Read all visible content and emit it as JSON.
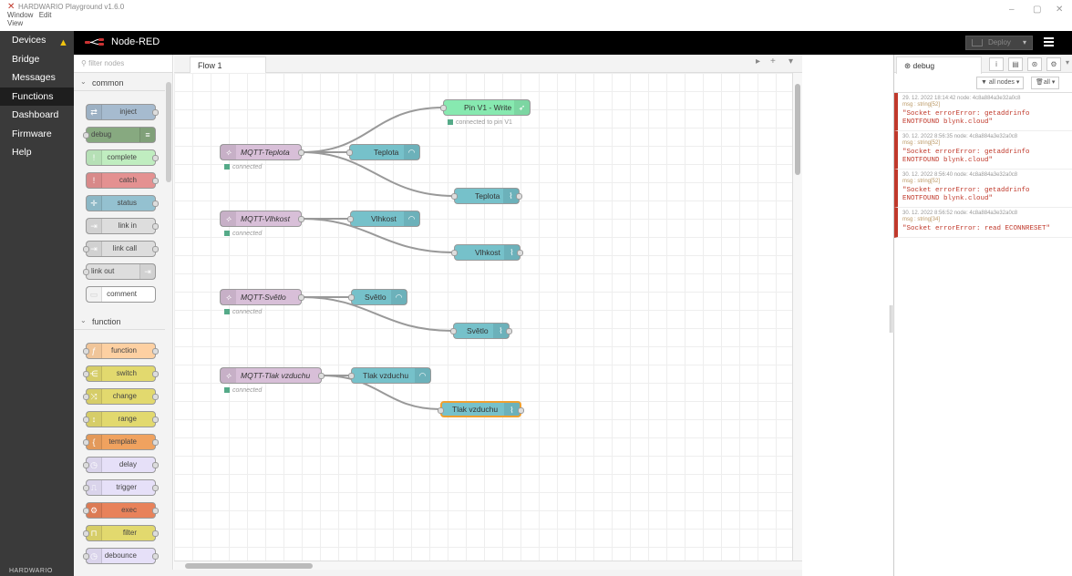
{
  "window": {
    "title": "HARDWARIO Playground v1.6.0",
    "menu": [
      "Window",
      "Edit",
      "View"
    ]
  },
  "app_nav": {
    "items": [
      {
        "label": "Devices",
        "warning": true
      },
      {
        "label": "Bridge"
      },
      {
        "label": "Messages"
      },
      {
        "label": "Functions",
        "active": true
      },
      {
        "label": "Dashboard"
      },
      {
        "label": "Firmware"
      },
      {
        "label": "Help"
      }
    ],
    "brand": "HARDWARIO"
  },
  "header": {
    "title": "Node-RED",
    "deploy_label": "Deploy"
  },
  "palette": {
    "filter_placeholder": "filter nodes",
    "categories": [
      {
        "label": "common",
        "nodes": [
          "inject",
          "debug",
          "complete",
          "catch",
          "status",
          "link in",
          "link call",
          "link out",
          "comment"
        ]
      },
      {
        "label": "function",
        "nodes": [
          "function",
          "switch",
          "change",
          "range",
          "template",
          "delay",
          "trigger",
          "exec",
          "filter",
          "debounce"
        ]
      }
    ]
  },
  "workspace": {
    "tab": "Flow 1",
    "nodes": {
      "pin_v1": {
        "label": "Pin V1 - Write",
        "status": "connected to pin V1"
      },
      "mqtt_teplota": {
        "label": "MQTT-Teplota",
        "status": "connected"
      },
      "teplota_gauge": {
        "label": "Teplota"
      },
      "teplota_chart": {
        "label": "Teplota"
      },
      "mqtt_vlhkost": {
        "label": "MQTT-Vlhkost",
        "status": "connected"
      },
      "vlhkost_gauge": {
        "label": "Vlhkost"
      },
      "vlhkost_chart": {
        "label": "Vlhkost"
      },
      "mqtt_svetlo": {
        "label": "MQTT-Světlo",
        "status": "connected"
      },
      "svetlo_gauge": {
        "label": "Světlo"
      },
      "svetlo_chart": {
        "label": "Světlo"
      },
      "mqtt_tlak": {
        "label": "MQTT-Tlak vzduchu",
        "status": "connected"
      },
      "tlak_gauge": {
        "label": "Tlak vzduchu"
      },
      "tlak_chart": {
        "label": "Tlak vzduchu"
      }
    }
  },
  "debug": {
    "tab_label": "debug",
    "filter_nodes": "all nodes",
    "filter_clear": "all",
    "messages": [
      {
        "meta": "29. 12. 2022 18:14:42  node: 4c8a884a3e32a0c8",
        "type": "msg : string[52]",
        "value": "\"Socket errorError: getaddrinfo ENOTFOUND blynk.cloud\""
      },
      {
        "meta": "30. 12. 2022 8:56:35  node: 4c8a884a3e32a0c8",
        "type": "msg : string[52]",
        "value": "\"Socket errorError: getaddrinfo ENOTFOUND blynk.cloud\""
      },
      {
        "meta": "30. 12. 2022 8:56:40  node: 4c8a884a3e32a0c8",
        "type": "msg : string[52]",
        "value": "\"Socket errorError: getaddrinfo ENOTFOUND blynk.cloud\""
      },
      {
        "meta": "30. 12. 2022 8:56:52  node: 4c8a884a3e32a0c8",
        "type": "msg : string[34]",
        "value": "\"Socket errorError: read ECONNRESET\""
      }
    ]
  }
}
